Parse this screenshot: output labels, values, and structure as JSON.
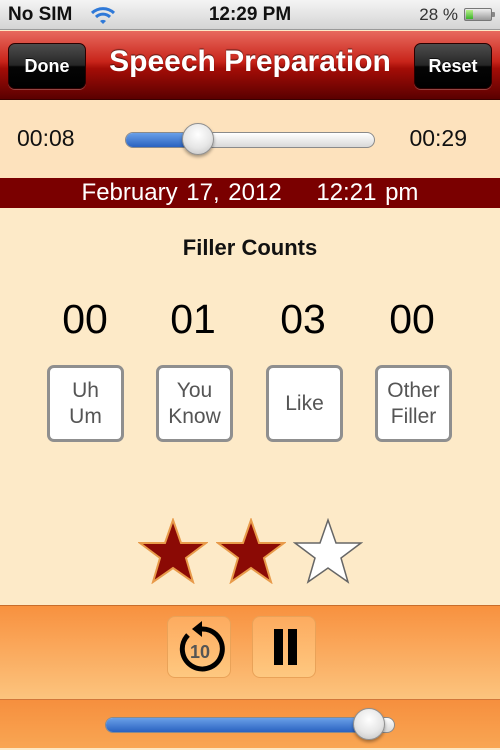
{
  "status_bar": {
    "carrier": "No SIM",
    "wifi_icon": "wifi-icon",
    "time": "12:29 PM",
    "battery_percent_label": "28 %",
    "battery_level": 0.28
  },
  "nav": {
    "title": "Speech Preparation",
    "left_button": "Done",
    "right_button": "Reset"
  },
  "playback": {
    "elapsed": "00:08",
    "duration": "00:29",
    "position_fraction": 0.29
  },
  "recording": {
    "date": "February 17, 2012",
    "time": "12:21 pm"
  },
  "filler": {
    "title": "Filler Counts",
    "items": [
      {
        "count": "00",
        "label": "Uh\nUm"
      },
      {
        "count": "01",
        "label": "You\nKnow"
      },
      {
        "count": "03",
        "label": "Like"
      },
      {
        "count": "00",
        "label": "Other\nFiller"
      }
    ]
  },
  "rating": {
    "value": 2,
    "max": 3,
    "filled_color": "#8b0a05",
    "empty_color": "#ffffff"
  },
  "controls": {
    "rewind_icon": "rewind-10-icon",
    "rewind_seconds": "10",
    "pause_icon": "pause-icon"
  },
  "volume": {
    "level_fraction": 0.91
  },
  "colors": {
    "nav_red": "#a40d07",
    "date_bar": "#7a0000",
    "background": "#fdeac8",
    "controls_orange": "#f8913f",
    "slider_blue": "#2a62c0"
  }
}
